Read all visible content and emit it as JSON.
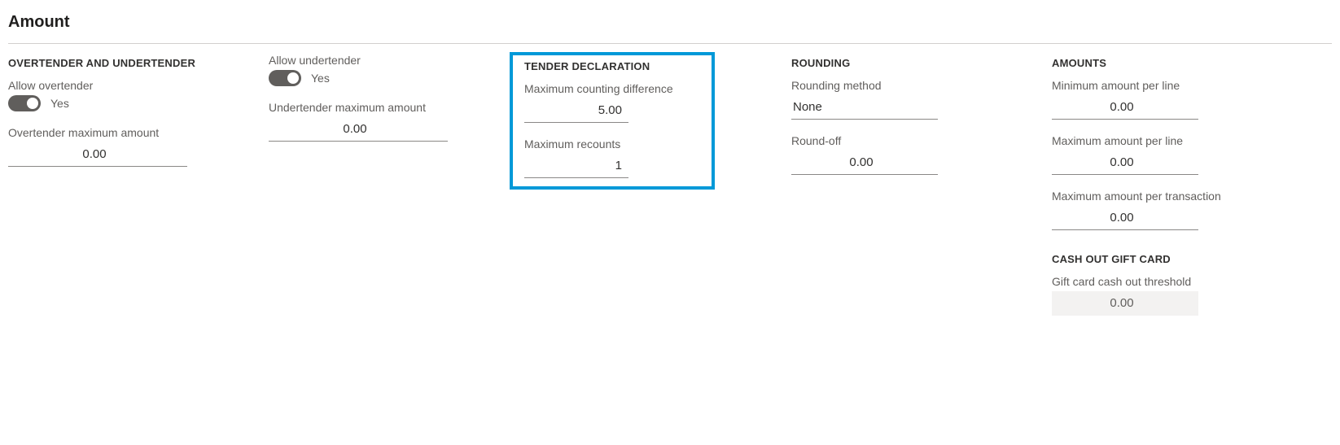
{
  "page": {
    "title": "Amount"
  },
  "overtender": {
    "heading": "OVERTENDER AND UNDERTENDER",
    "allow_overtender_label": "Allow overtender",
    "allow_overtender_value": "Yes",
    "overtender_max_amount_label": "Overtender maximum amount",
    "overtender_max_amount_value": "0.00"
  },
  "undertender": {
    "allow_undertender_label": "Allow undertender",
    "allow_undertender_value": "Yes",
    "undertender_max_amount_label": "Undertender maximum amount",
    "undertender_max_amount_value": "0.00"
  },
  "tender_declaration": {
    "heading": "TENDER DECLARATION",
    "max_counting_diff_label": "Maximum counting difference",
    "max_counting_diff_value": "5.00",
    "max_recounts_label": "Maximum recounts",
    "max_recounts_value": "1"
  },
  "rounding": {
    "heading": "ROUNDING",
    "method_label": "Rounding method",
    "method_value": "None",
    "roundoff_label": "Round-off",
    "roundoff_value": "0.00"
  },
  "amounts": {
    "heading": "AMOUNTS",
    "min_per_line_label": "Minimum amount per line",
    "min_per_line_value": "0.00",
    "max_per_line_label": "Maximum amount per line",
    "max_per_line_value": "0.00",
    "max_per_transaction_label": "Maximum amount per transaction",
    "max_per_transaction_value": "0.00"
  },
  "cash_out_gift_card": {
    "heading": "CASH OUT GIFT CARD",
    "threshold_label": "Gift card cash out threshold",
    "threshold_value": "0.00"
  }
}
